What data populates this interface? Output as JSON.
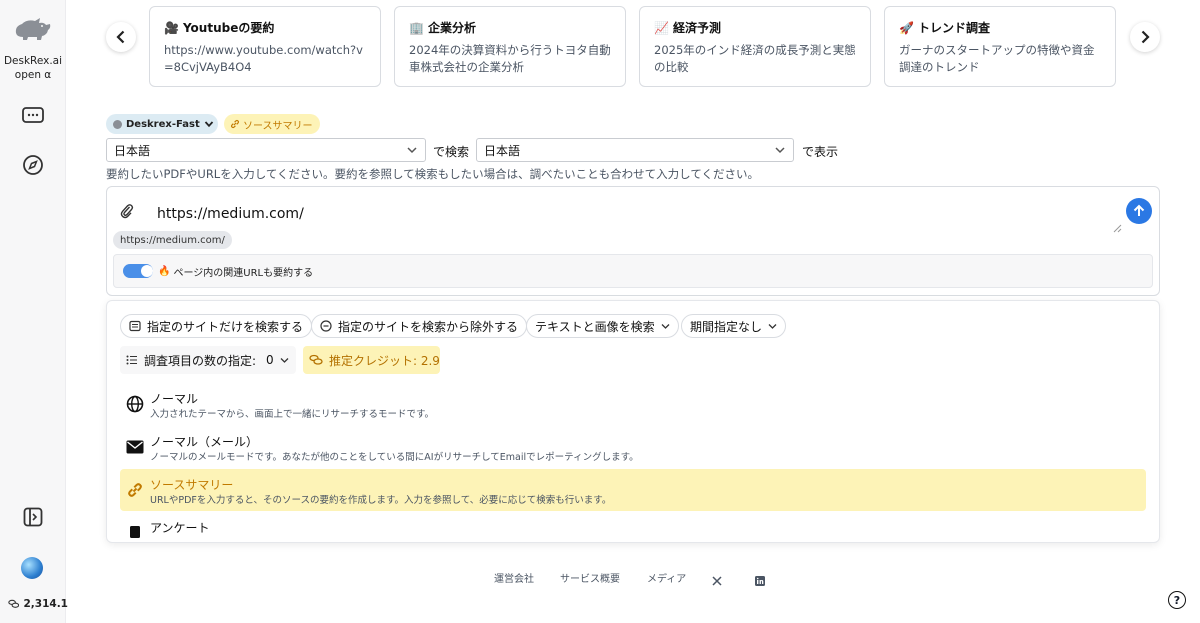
{
  "sidebar": {
    "brand_name": "DeskRex.ai",
    "brand_version": "open α",
    "credits": "2,314.1",
    "icons": [
      "chat-icon",
      "compass-icon",
      "panel-toggle-icon"
    ]
  },
  "cards": [
    {
      "icon": "🎥",
      "title": "Youtubeの要約",
      "desc": "https://www.youtube.com/watch?v=8CvjVAyB4O4"
    },
    {
      "icon": "🏢",
      "title": "企業分析",
      "desc": "2024年の決算資料から行うトヨタ自動車株式会社の企業分析"
    },
    {
      "icon": "📈",
      "title": "経済予測",
      "desc": "2025年のインド経済の成長予測と実態の比較"
    },
    {
      "icon": "🚀",
      "title": "トレンド調査",
      "desc": "ガーナのスタートアップの特徴や資金調達のトレンド"
    }
  ],
  "model_chip": "Deskrex-Fast",
  "mode_chip": "ソースサマリー",
  "language": {
    "search_lang": "日本語",
    "search_suffix": "で検索",
    "display_lang": "日本語",
    "display_suffix": "で表示"
  },
  "hint": "要約したいPDFやURLを入力してください。要約を参照して検索もしたい場合は、調べたいことも合わせて入力してください。",
  "input": {
    "value": "https://medium.com/",
    "url_chip": "https://medium.com/",
    "toggle_label": "ページ内の関連URLも要約する",
    "toggle_on": true
  },
  "options": {
    "include_sites": "指定のサイトだけを検索する",
    "exclude_sites": "指定のサイトを検索から除外する",
    "search_type": "テキストと画像を検索",
    "period": "期間指定なし",
    "count_label": "調査項目の数の指定:",
    "count_value": "0",
    "credit_estimate": "推定クレジット: 2.9"
  },
  "modes": [
    {
      "icon": "globe-icon",
      "name": "ノーマル",
      "desc": "入力されたテーマから、画面上で一緒にリサーチするモードです。",
      "active": false
    },
    {
      "icon": "mail-icon",
      "name": "ノーマル（メール）",
      "desc": "ノーマルのメールモードです。あなたが他のことをしている間にAIがリサーチしてEmailでレポーティングします。",
      "active": false
    },
    {
      "icon": "link-icon",
      "name": "ソースサマリー",
      "desc": "URLやPDFを入力すると、そのソースの要約を作成します。入力を参照して、必要に応じて検索も行います。",
      "active": true
    },
    {
      "icon": "survey-icon",
      "name": "アンケート",
      "desc": "",
      "active": false
    }
  ],
  "footer": {
    "links": [
      "運営会社",
      "サービス概要",
      "メディア"
    ],
    "help": "?"
  },
  "colors": {
    "accent": "#2b78e4",
    "highlight": "#fdf3b7",
    "highlight_text": "#c17a00"
  }
}
